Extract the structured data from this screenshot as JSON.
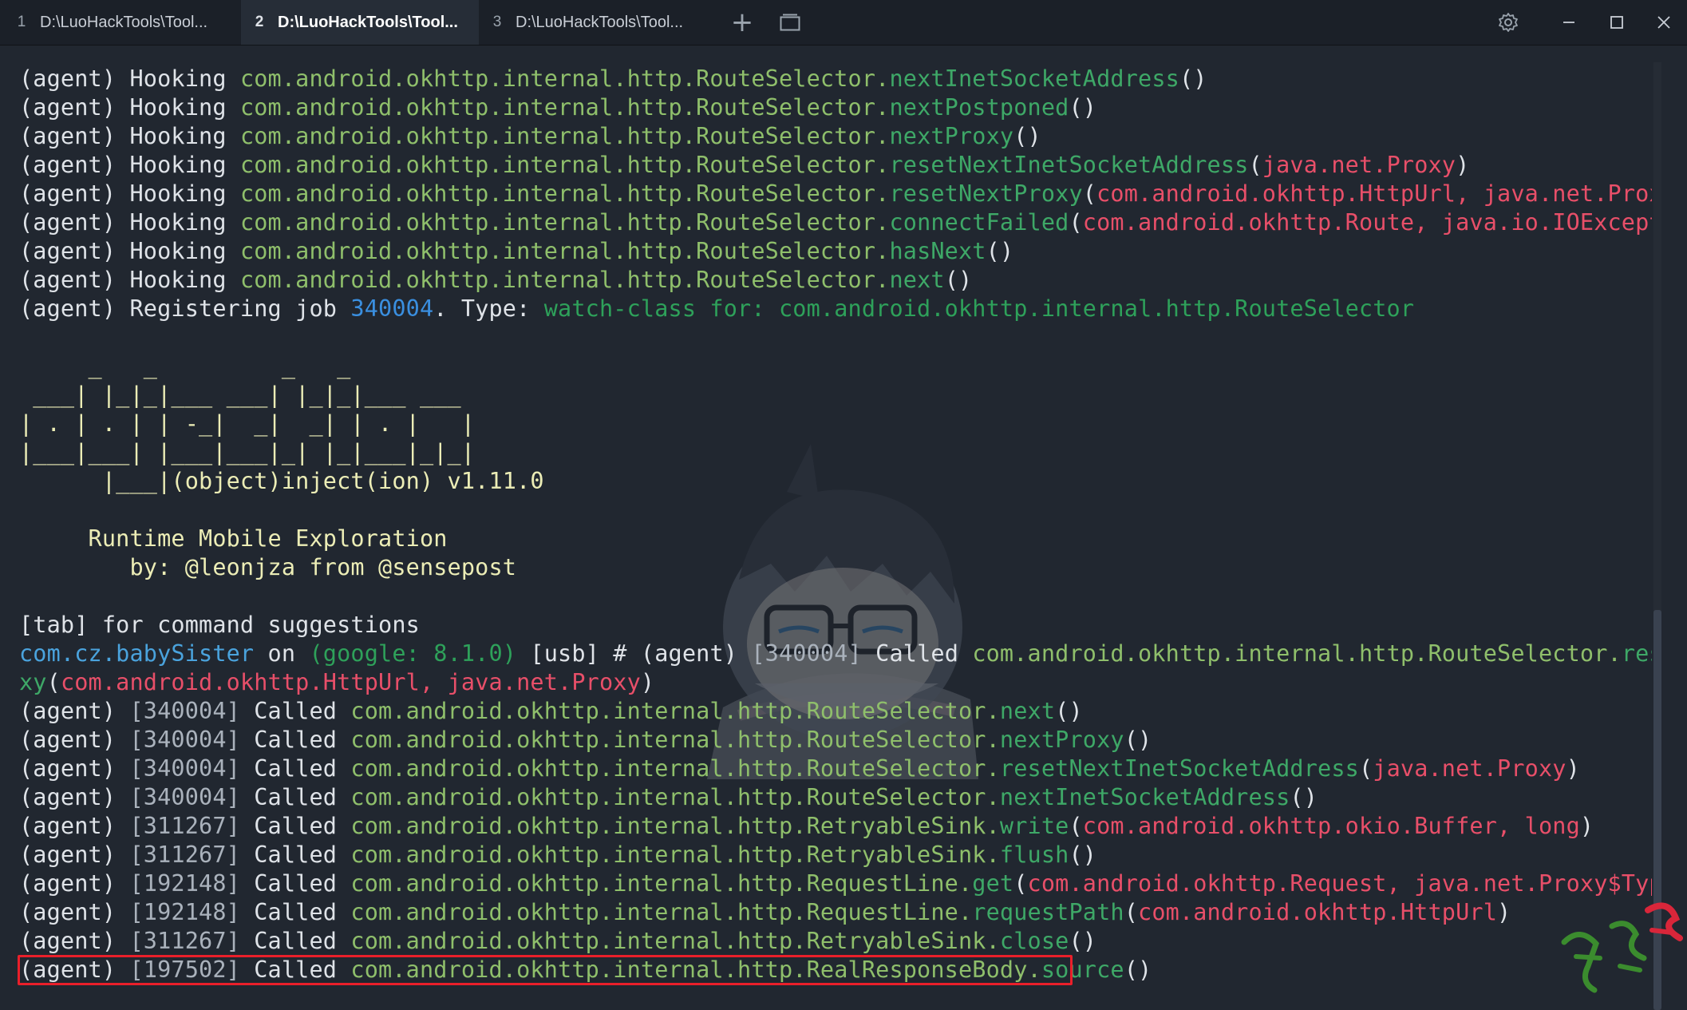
{
  "tabs": [
    {
      "num": "1",
      "title": "D:\\LuoHackTools\\Tool..."
    },
    {
      "num": "2",
      "title": "D:\\LuoHackTools\\Tool...",
      "active": true
    },
    {
      "num": "3",
      "title": "D:\\LuoHackTools\\Tool..."
    }
  ],
  "controls": {
    "new_tab": "+"
  },
  "terminal": {
    "prefix": "(agent) Hooking ",
    "pkg": "com.android.okhttp.internal.http.",
    "cls_route": "RouteSelector.",
    "hooks": [
      {
        "m": "nextInetSocketAddress",
        "a": ""
      },
      {
        "m": "nextPostponed",
        "a": ""
      },
      {
        "m": "nextProxy",
        "a": ""
      },
      {
        "m": "resetNextInetSocketAddress",
        "a": "java.net.Proxy"
      },
      {
        "m": "resetNextProxy",
        "a": "com.android.okhttp.HttpUrl, java.net.Proxy"
      },
      {
        "m": "connectFailed",
        "a": "com.android.okhttp.Route, java.io.IOException"
      },
      {
        "m": "hasNext",
        "a": ""
      },
      {
        "m": "next",
        "a": ""
      }
    ],
    "register": {
      "pre": "(agent) Registering job ",
      "job": "340004",
      "mid": ". Type: ",
      "type": "watch-class for: com.android.okhttp.internal.http.RouteSelector"
    },
    "banner": [
      "     _   _         _   _",
      " ___| |_|_|___ ___| |_|_|___ ___",
      "| . | . | | -_|  _|  _| | . |   |",
      "|___|___| |___|___|_| |_|___|_|_|",
      "      |___|(object)inject(ion) v1.11.0",
      "",
      "     Runtime Mobile Exploration",
      "        by: @leonjza from @sensepost"
    ],
    "hint": "[tab] for command suggestions",
    "prompt": {
      "app": "com.cz.babySister",
      "on": " on ",
      "device": "(google: 8.1.0)",
      "usb": " [usb] # ",
      "agent": "(agent) ",
      "job": "[340004]",
      "called": " Called ",
      "cls": "com.android.okhttp.internal.http.RouteSelector.",
      "method_a": "resetNextPro",
      "method_b": "xy",
      "args": "com.android.okhttp.HttpUrl, java.net.Proxy"
    },
    "calls": [
      {
        "job": "[340004]",
        "cls": "RouteSelector.",
        "m": "next",
        "a": ""
      },
      {
        "job": "[340004]",
        "cls": "RouteSelector.",
        "m": "nextProxy",
        "a": ""
      },
      {
        "job": "[340004]",
        "cls": "RouteSelector.",
        "m": "resetNextInetSocketAddress",
        "a": "java.net.Proxy"
      },
      {
        "job": "[340004]",
        "cls": "RouteSelector.",
        "m": "nextInetSocketAddress",
        "a": ""
      },
      {
        "job": "[311267]",
        "cls": "RetryableSink.",
        "m": "write",
        "a": "com.android.okhttp.okio.Buffer, long"
      },
      {
        "job": "[311267]",
        "cls": "RetryableSink.",
        "m": "flush",
        "a": ""
      },
      {
        "job": "[192148]",
        "cls": "RequestLine.",
        "m": "get",
        "a": "com.android.okhttp.Request, java.net.Proxy$Type"
      },
      {
        "job": "[192148]",
        "cls": "RequestLine.",
        "m": "requestPath",
        "a": "com.android.okhttp.HttpUrl"
      },
      {
        "job": "[311267]",
        "cls": "RetryableSink.",
        "m": "close",
        "a": ""
      },
      {
        "job": "[197502]",
        "cls": "RealResponseBody.",
        "m": "source",
        "a": ""
      }
    ],
    "called_prefix": "(agent) ",
    "called_word": " Called "
  },
  "colors": {
    "accent_highlight": "#ea1f2a",
    "method": "#3ea867",
    "args": "#e84f69",
    "job": "#3a8fe0"
  }
}
